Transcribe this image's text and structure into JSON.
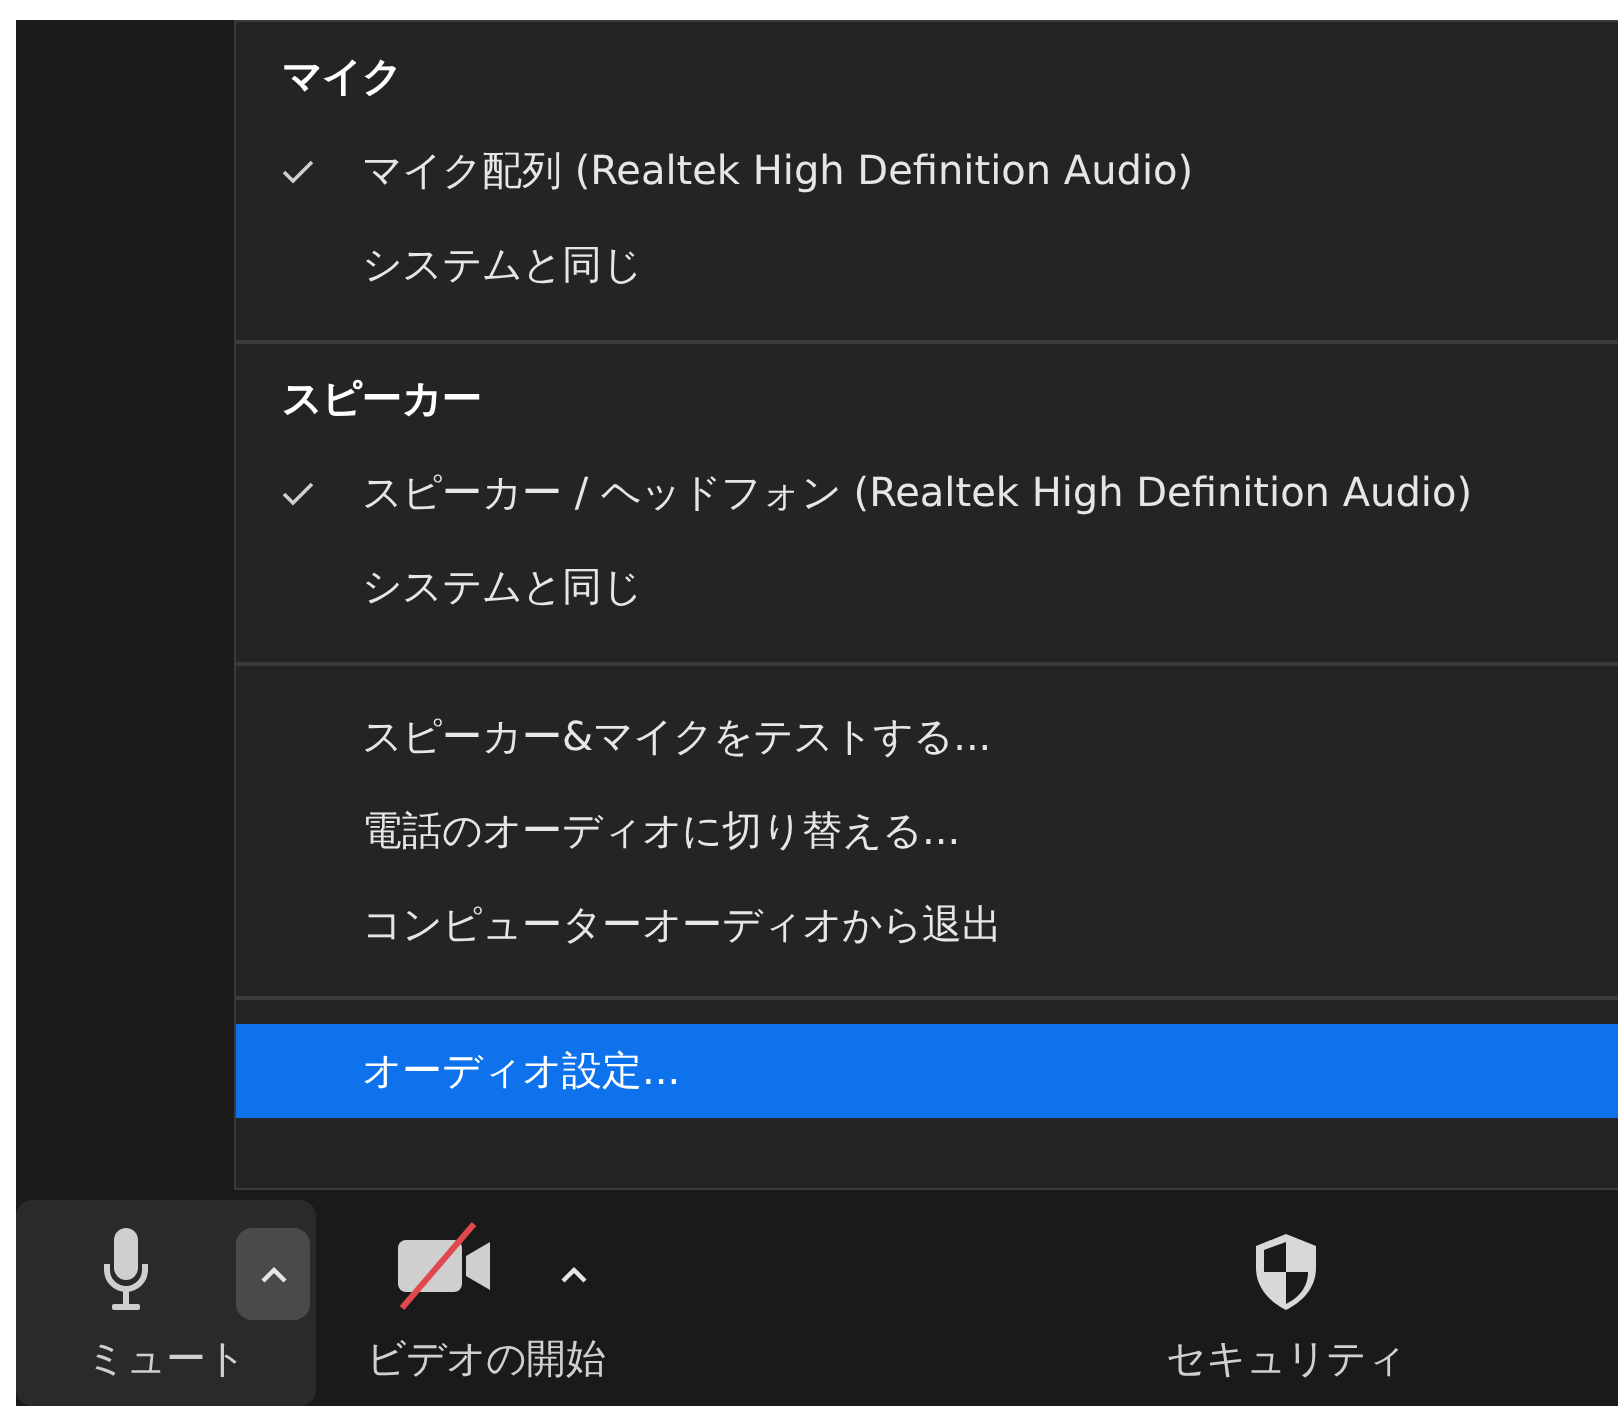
{
  "menu": {
    "sections": [
      {
        "heading": "マイク",
        "items": [
          {
            "label": "マイク配列 (Realtek High Definition Audio)",
            "checked": true,
            "selected": false
          },
          {
            "label": "システムと同じ",
            "checked": false,
            "selected": false
          }
        ]
      },
      {
        "heading": "スピーカー",
        "items": [
          {
            "label": "スピーカー / ヘッドフォン (Realtek High Definition Audio)",
            "checked": true,
            "selected": false
          },
          {
            "label": "システムと同じ",
            "checked": false,
            "selected": false
          }
        ]
      },
      {
        "items": [
          {
            "label": "スピーカー&マイクをテストする...",
            "checked": false,
            "selected": false
          },
          {
            "label": "電話のオーディオに切り替える...",
            "checked": false,
            "selected": false
          },
          {
            "label": "コンピューターオーディオから退出",
            "checked": false,
            "selected": false
          }
        ]
      },
      {
        "items": [
          {
            "label": "オーディオ設定...",
            "checked": false,
            "selected": true
          }
        ]
      }
    ]
  },
  "toolbar": [
    {
      "kind": "mic",
      "label": "ミュート",
      "caret": true,
      "active": true
    },
    {
      "kind": "video",
      "label": "ビデオの開始",
      "caret": true,
      "active": false
    },
    {
      "kind": "security",
      "label": "セキュリティ",
      "caret": false,
      "active": false
    }
  ]
}
